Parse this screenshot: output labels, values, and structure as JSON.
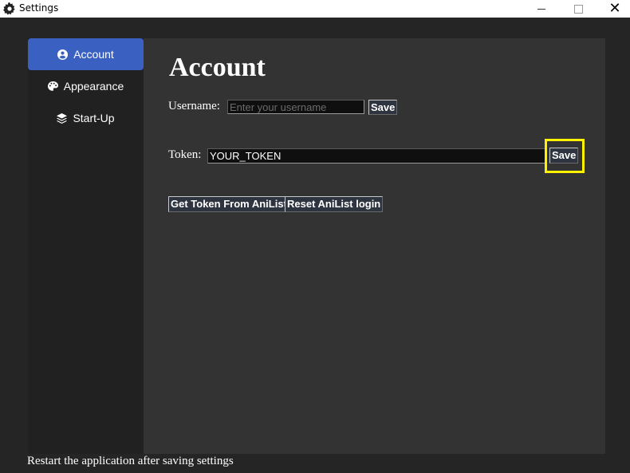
{
  "window": {
    "title": "Settings",
    "icon": "gear-icon"
  },
  "sidebar": {
    "items": [
      {
        "label": "Account",
        "icon": "user-circle-icon",
        "active": true
      },
      {
        "label": "Appearance",
        "icon": "palette-icon",
        "active": false
      },
      {
        "label": "Start-Up",
        "icon": "layers-icon",
        "active": false
      }
    ]
  },
  "account": {
    "title": "Account",
    "username_label": "Username:",
    "username_placeholder": "Enter your username",
    "username_value": "",
    "username_save": "Save",
    "token_label": "Token:",
    "token_value": "YOUR_TOKEN",
    "token_save": "Save",
    "get_token_label": "Get Token From AniList",
    "reset_login_label": "Reset AniList login"
  },
  "footer": {
    "text": "Restart the application after saving settings"
  },
  "colors": {
    "accent": "#3a60c2",
    "highlight": "#fff200",
    "background": "#252525",
    "panel": "#333333"
  }
}
